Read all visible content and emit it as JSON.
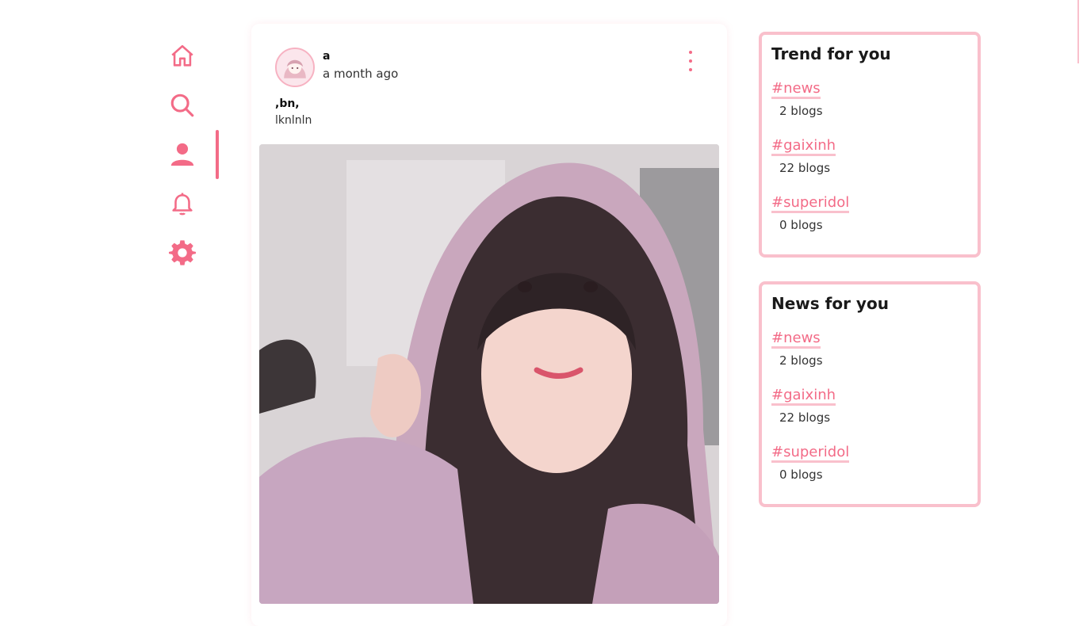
{
  "sidebar": {
    "items": [
      {
        "icon": "home-icon"
      },
      {
        "icon": "search-icon"
      },
      {
        "icon": "user-icon",
        "active": true
      },
      {
        "icon": "bell-icon"
      },
      {
        "icon": "gear-icon"
      }
    ],
    "accent_color": "#f36b87"
  },
  "post": {
    "author": "a",
    "time": "a month ago",
    "title": ",bn,",
    "body": "lknlnln"
  },
  "trend": {
    "title": "Trend for you",
    "tags": [
      {
        "tag": "#news",
        "count": "2 blogs"
      },
      {
        "tag": "#gaixinh",
        "count": "22 blogs"
      },
      {
        "tag": "#superidol",
        "count": "0 blogs"
      }
    ]
  },
  "news": {
    "title": "News for you",
    "tags": [
      {
        "tag": "#news",
        "count": "2 blogs"
      },
      {
        "tag": "#gaixinh",
        "count": "22 blogs"
      },
      {
        "tag": "#superidol",
        "count": "0 blogs"
      }
    ]
  }
}
